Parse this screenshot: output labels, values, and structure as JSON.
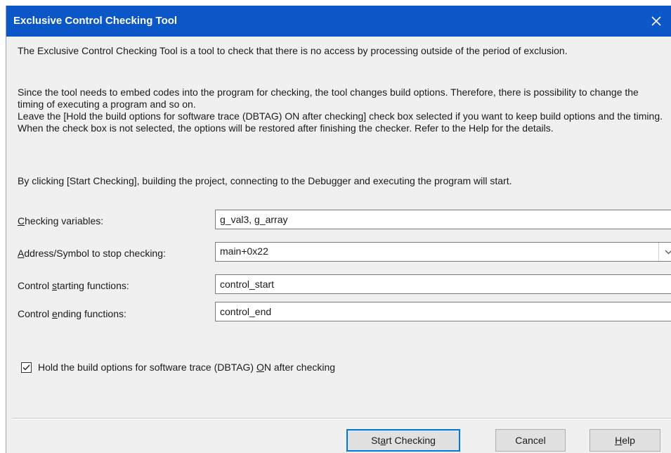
{
  "window": {
    "title": "Exclusive Control Checking Tool"
  },
  "description": {
    "p1": "The Exclusive Control Checking Tool is a tool to check that there is no access by processing outside of the period of exclusion.",
    "p2_line1": "Since the tool needs to embed codes into the program for checking, the tool changes build options. Therefore, there is possibility to change the timing of executing a program and so on.",
    "p2_line2": "Leave the [Hold the build options for software trace (DBTAG) ON after checking] check box selected if you want to keep build options and the timing. When the check box is not selected, the options will be restored after finishing the checker. Refer to the Help for the details.",
    "p3": "By clicking [Start Checking], building the project, connecting to the Debugger and executing the program will start."
  },
  "form": {
    "checking_variables": {
      "label_prefix": "",
      "label_accel": "C",
      "label_rest": "hecking variables:",
      "value": "g_val3, g_array"
    },
    "stop_address": {
      "label_prefix": "",
      "label_accel": "A",
      "label_rest": "ddress/Symbol to stop checking:",
      "value": "main+0x22"
    },
    "start_functions": {
      "label_prefix": "Control ",
      "label_accel": "s",
      "label_rest": "tarting functions:",
      "value": "control_start"
    },
    "end_functions": {
      "label_prefix": "Control ",
      "label_accel": "e",
      "label_rest": "nding functions:",
      "value": "control_end"
    }
  },
  "hold_option": {
    "checked": true,
    "label_prefix": "Hold the build options for software trace (DBTAG) ",
    "label_accel": "O",
    "label_rest": "N after checking"
  },
  "buttons": {
    "start": {
      "prefix": "St",
      "accel": "a",
      "rest": "rt Checking"
    },
    "cancel": {
      "prefix": "",
      "accel": "",
      "rest": "Cancel"
    },
    "help": {
      "prefix": "",
      "accel": "H",
      "rest": "elp"
    }
  },
  "colors": {
    "titlebar": "#0c57c7",
    "dialog_bg": "#f0f0f0",
    "default_button_border": "#0078d7"
  }
}
